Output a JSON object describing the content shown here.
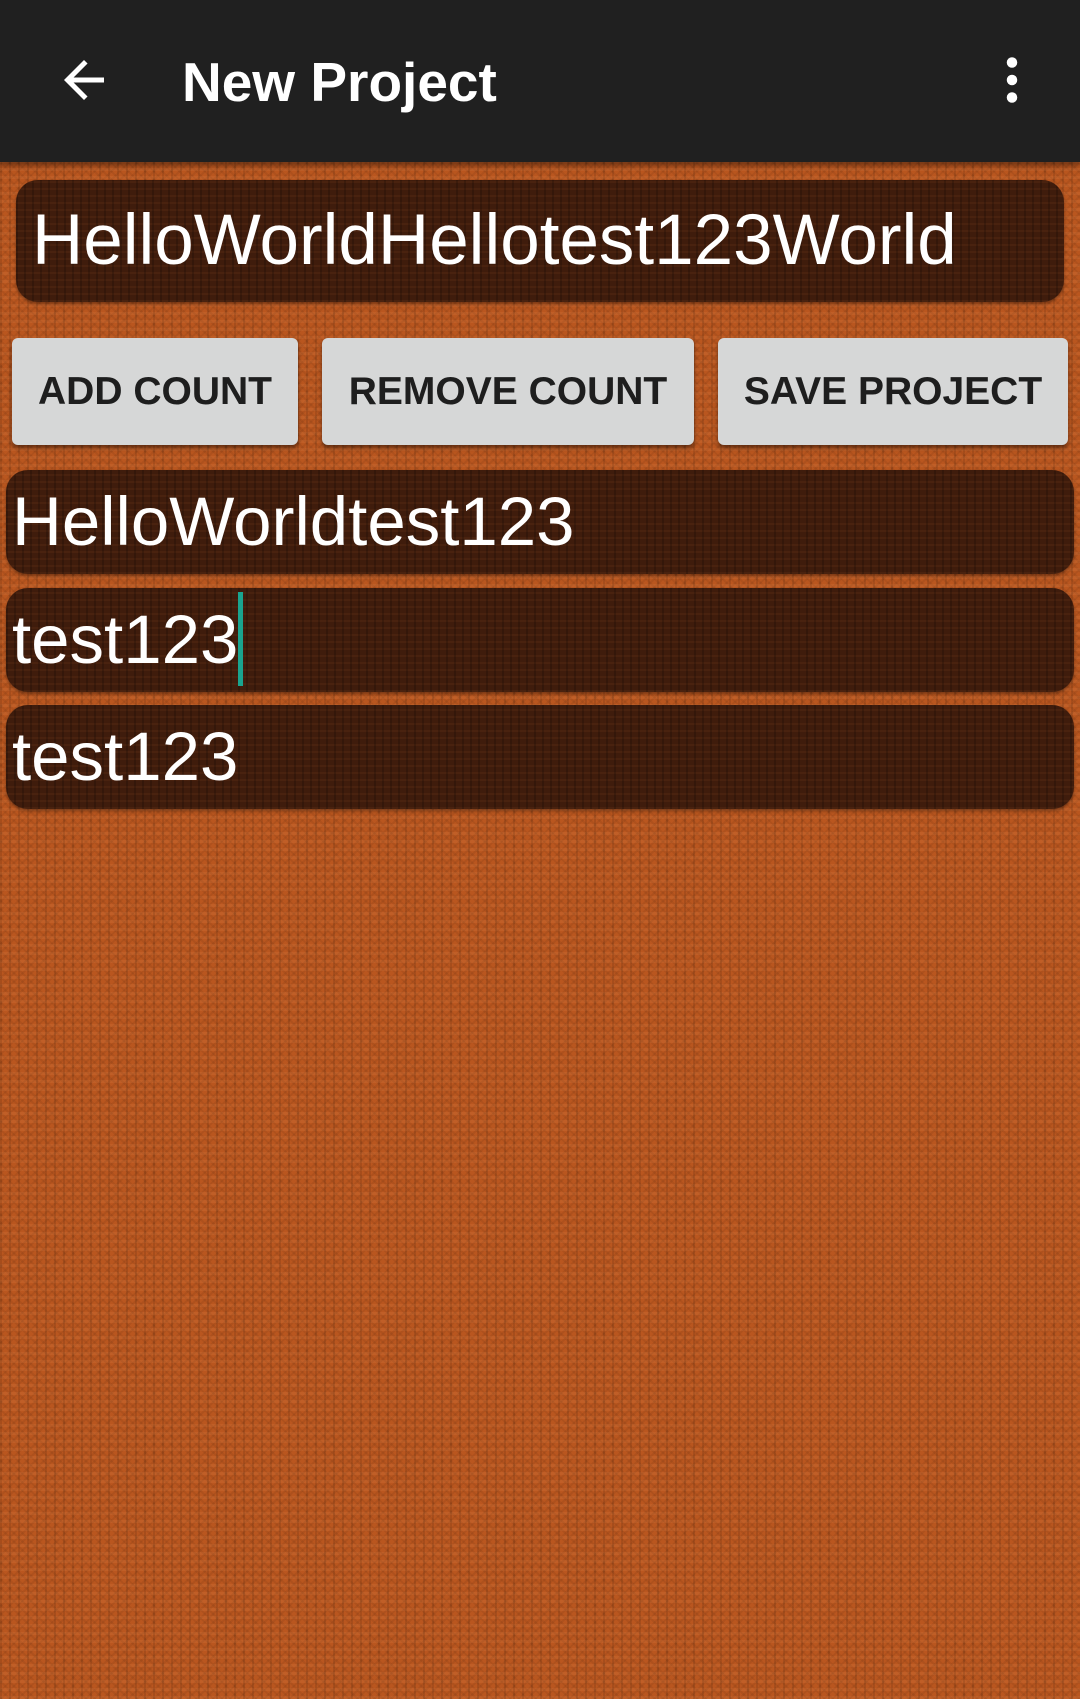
{
  "app_bar": {
    "title": "New Project",
    "back_icon": "arrow-back-icon",
    "overflow_icon": "more-vert-icon"
  },
  "project_name": {
    "value": "HelloWorldHellotest123World"
  },
  "buttons": {
    "add_count": "ADD COUNT",
    "remove_count": "REMOVE COUNT",
    "save_project": "SAVE PROJECT"
  },
  "counts": [
    {
      "value": "HelloWorldtest123"
    },
    {
      "value": "test123",
      "focused": true
    },
    {
      "value": "test123"
    }
  ],
  "colors": {
    "app_bar": "#202020",
    "background": "#b9561f",
    "field": "#3f1c0c",
    "button": "#d6d7d7",
    "caret": "#1aa48f"
  }
}
